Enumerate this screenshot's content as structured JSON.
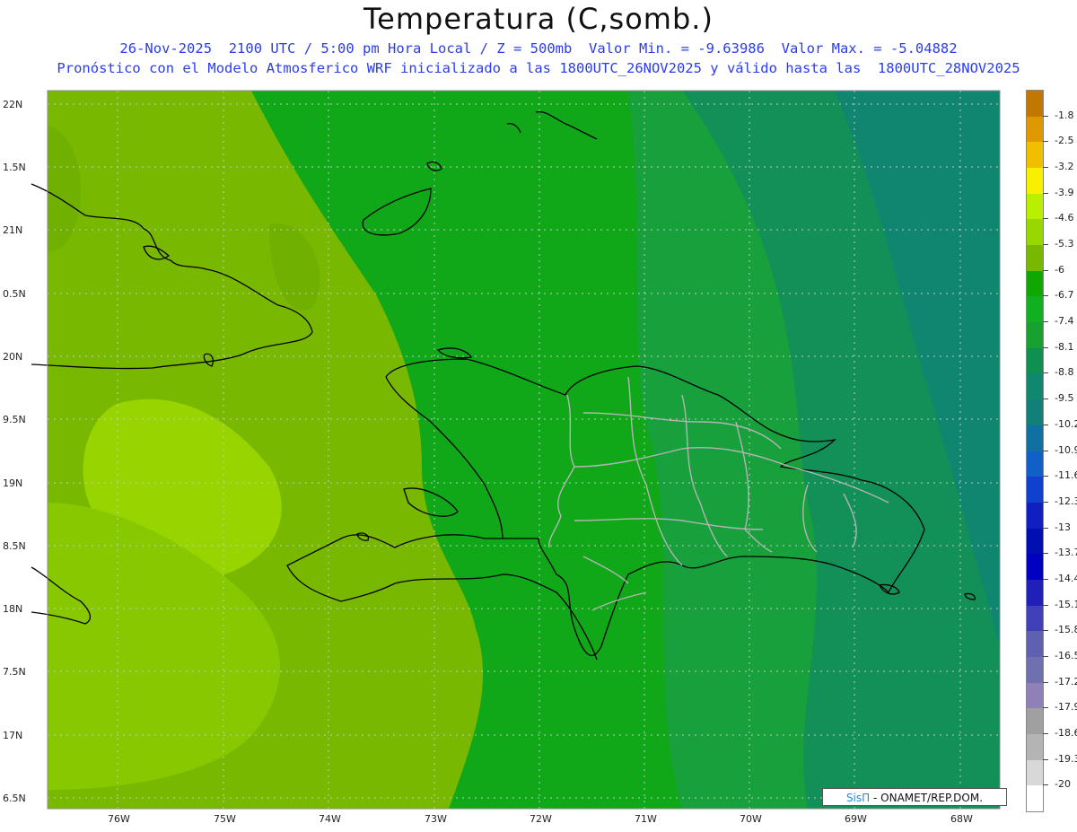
{
  "header": {
    "title": "Temperatura (C,somb.)",
    "line1": "26-Nov-2025  2100 UTC / 5:00 pm Hora Local / Z = 500mb  Valor Min. = -9.63986  Valor Max. = -5.04882",
    "line2": "Pronóstico con el Modelo Atmosferico WRF inicializado a las 1800UTC_26NOV2025 y válido hasta las  1800UTC_28NOV2025"
  },
  "axes": {
    "lat_labels": [
      "22N",
      "1.5N",
      "21N",
      "0.5N",
      "20N",
      "9.5N",
      "19N",
      "8.5N",
      "18N",
      "7.5N",
      "17N",
      "6.5N"
    ],
    "lon_labels": [
      "76W",
      "75W",
      "74W",
      "73W",
      "72W",
      "71W",
      "70W",
      "69W",
      "68W"
    ]
  },
  "legend": {
    "labels": [
      "-1.8",
      "-2.5",
      "-3.2",
      "-3.9",
      "-4.6",
      "-5.3",
      "-6",
      "-6.7",
      "-7.4",
      "-8.1",
      "-8.8",
      "-9.5",
      "-10.2",
      "-10.9",
      "-11.6",
      "-12.3",
      "-13",
      "-13.7",
      "-14.4",
      "-15.1",
      "-15.8",
      "-16.5",
      "-17.2",
      "-17.9",
      "-18.6",
      "-19.3",
      "-20"
    ],
    "colors": [
      "#c07800",
      "#e09800",
      "#f0c000",
      "#f8f000",
      "#b8f000",
      "#98d800",
      "#78b800",
      "#10a800",
      "#10b020",
      "#18a030",
      "#109050",
      "#108870",
      "#108078",
      "#1070a0",
      "#1060c8",
      "#1040d0",
      "#1020c0",
      "#0010b0",
      "#0000c0",
      "#2020b8",
      "#4040b8",
      "#6060b0",
      "#7070b0",
      "#9080b8",
      "#a0a0a0",
      "#b4b4b4",
      "#d8d8d8",
      "#ffffff"
    ]
  },
  "credit": {
    "brand": "SisΠ",
    "text": "- ONAMET/REP.DOM."
  }
}
